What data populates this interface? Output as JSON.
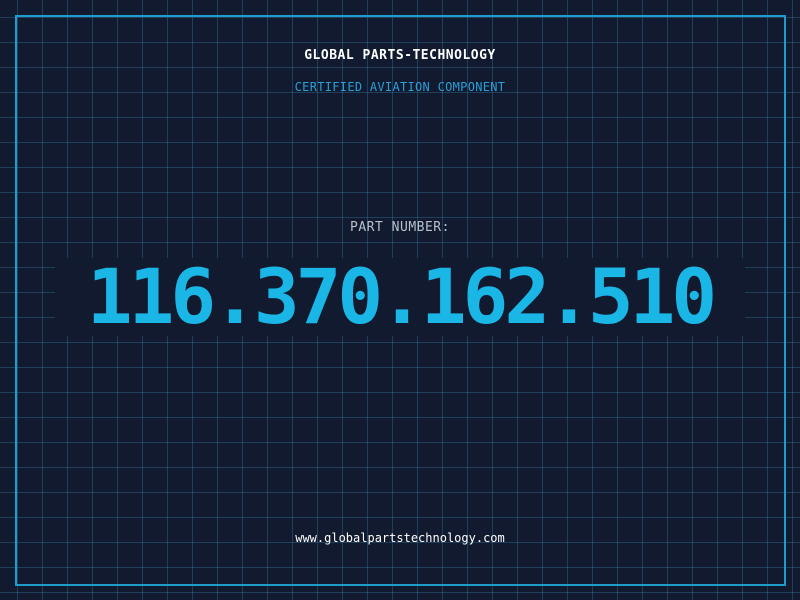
{
  "header": {
    "company": "GLOBAL PARTS-TECHNOLOGY",
    "subtitle": "CERTIFIED AVIATION COMPONENT"
  },
  "part": {
    "label": "PART NUMBER:",
    "number": "116.370.162.510"
  },
  "footer": {
    "website": "www.globalpartstechnology.com"
  },
  "colors": {
    "background": "#121a30",
    "grid": "#1f4f6a",
    "frame": "#1e9ccc",
    "accent": "#19b6e6",
    "subtitle": "#2a9fd6",
    "label": "#b7c0cc",
    "text": "#ffffff"
  }
}
